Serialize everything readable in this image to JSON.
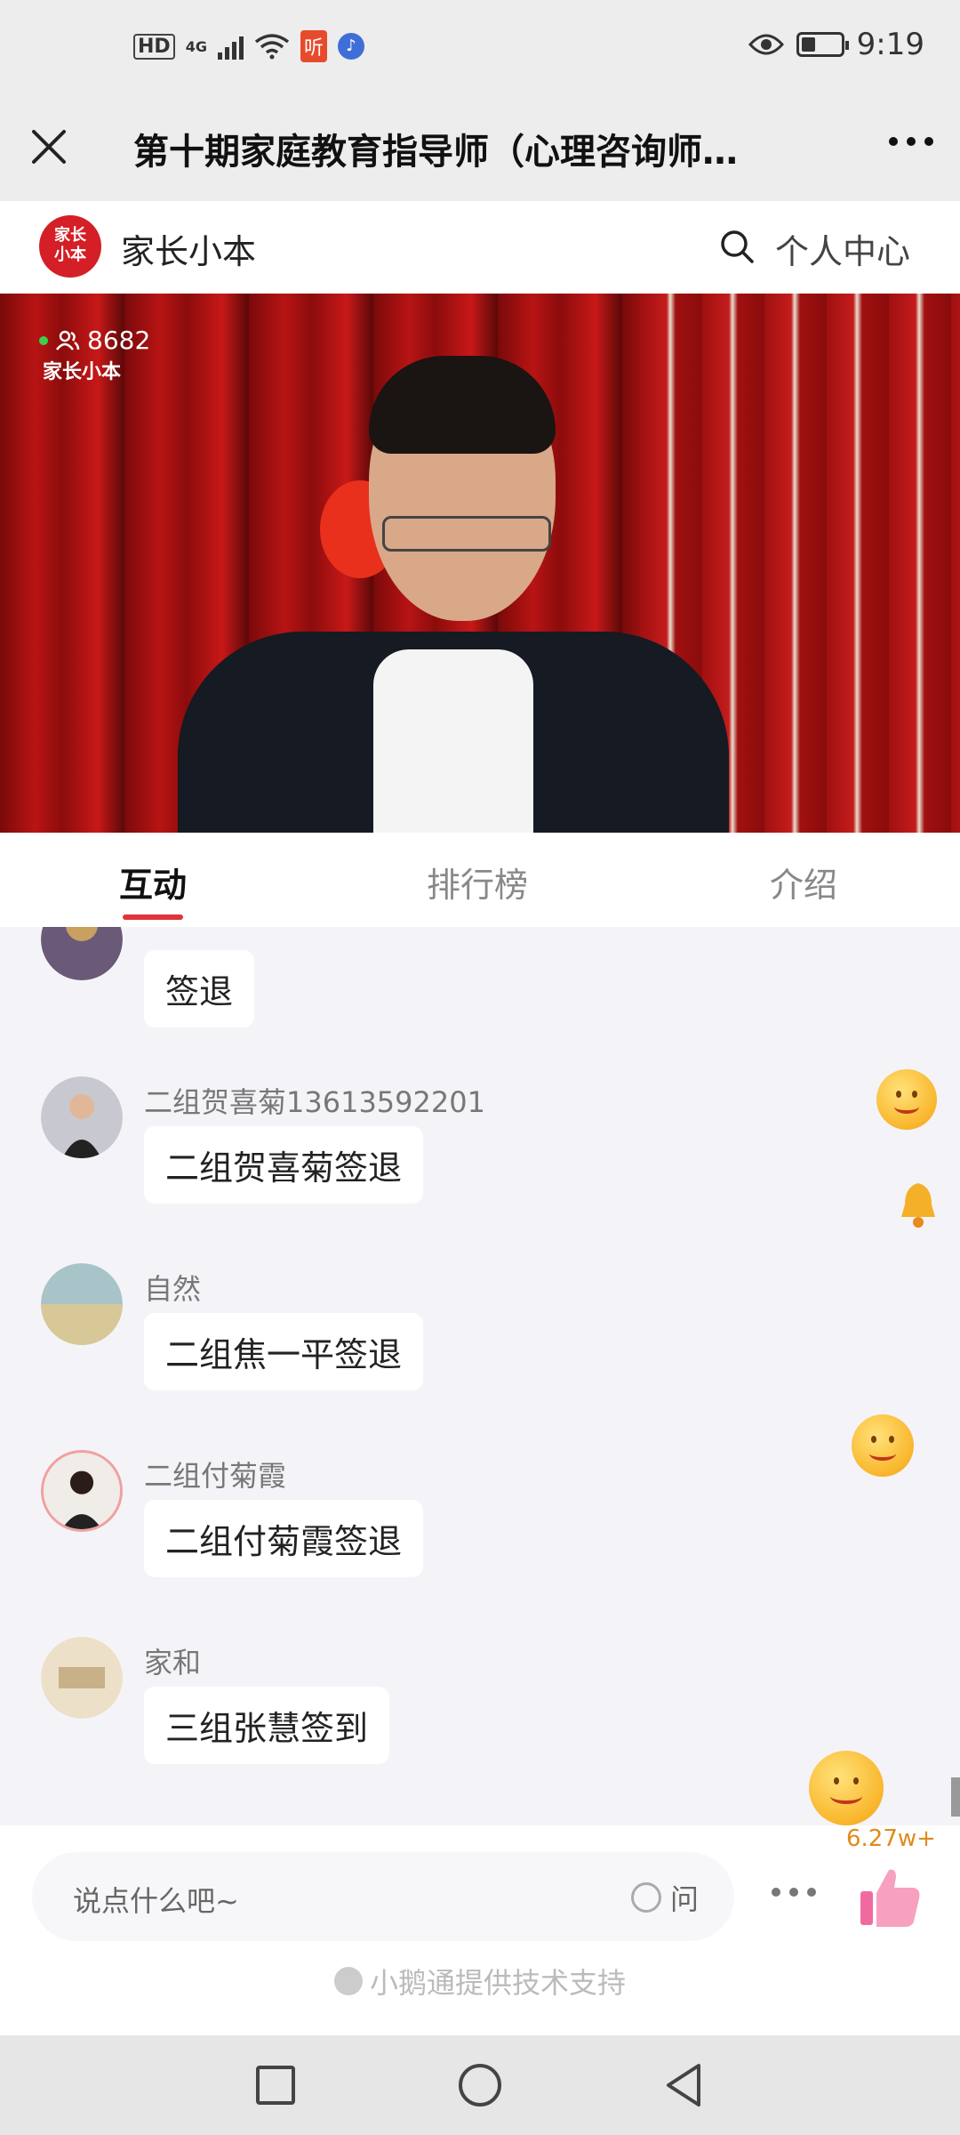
{
  "status_bar": {
    "hd": "HD",
    "network": "4G",
    "app_icon_red": "听",
    "time": "9:19",
    "battery_level": 0.35
  },
  "title_bar": {
    "title": "第十期家庭教育指导师（心理咨询师…",
    "close_icon": "close-icon",
    "more_icon": "more-icon"
  },
  "brand_bar": {
    "logo_text_1": "家长",
    "logo_text_2": "小本",
    "brand_name": "家长小本",
    "user_center": "个人中心"
  },
  "video": {
    "viewer_count": "8682",
    "watermark": "家长小本"
  },
  "tabs": [
    {
      "label": "互动",
      "active": true
    },
    {
      "label": "排行榜",
      "active": false
    },
    {
      "label": "介绍",
      "active": false
    }
  ],
  "messages": [
    {
      "nickname": "",
      "text": "签退",
      "avatar_color": "#6a5a78"
    },
    {
      "nickname": "二组贺喜菊13613592201",
      "text": "二组贺喜菊签退",
      "avatar_color": "#5a5a66"
    },
    {
      "nickname": "自然",
      "text": "二组焦一平签退",
      "avatar_color": "#b8c4a8"
    },
    {
      "nickname": "二组付菊霞",
      "text": "二组付菊霞签退",
      "avatar_color": "#e8c8c8"
    },
    {
      "nickname": "家和",
      "text": "三组张慧签到",
      "avatar_color": "#e8dcc8"
    }
  ],
  "input_bar": {
    "placeholder": "说点什么吧~",
    "ask_label": "问",
    "like_count": "6.27w+",
    "powered_by": "小鹅通提供技术支持"
  },
  "colors": {
    "accent": "#e0343c",
    "brand_red": "#d41f26",
    "like_orange": "#e08a1c"
  }
}
